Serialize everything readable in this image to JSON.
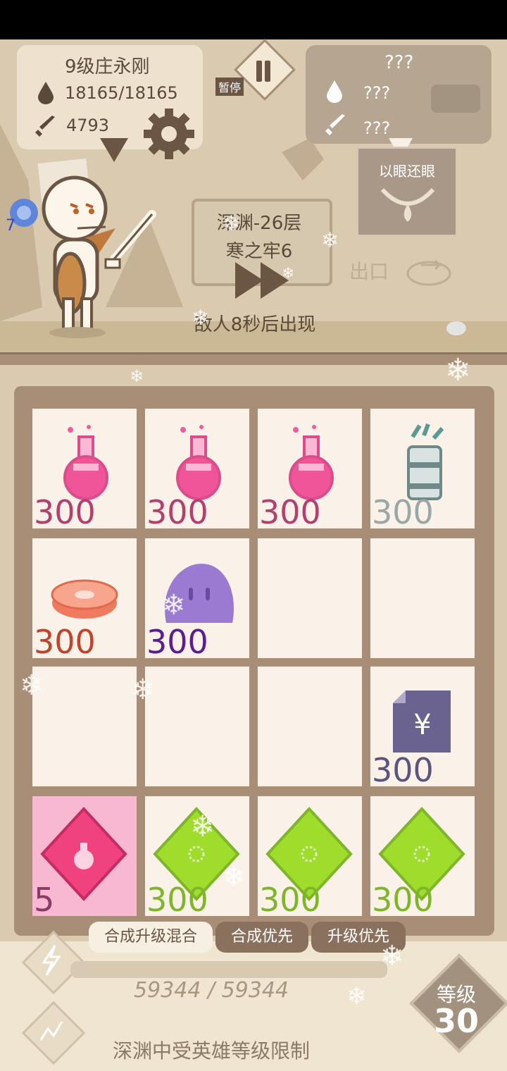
{
  "player": {
    "name": "9级庄永刚",
    "hp": "18165/18165",
    "atk": "4793"
  },
  "enemy": {
    "name": "???",
    "hp": "???",
    "atk": "???",
    "skill": "以眼还眼"
  },
  "pause_tag": "暂停",
  "stage": {
    "line1": "深渊-26层",
    "line2": "寒之牢6",
    "spawn_text": "敌人8秒后出现",
    "exit_text": "出口"
  },
  "buff_count": "7",
  "grid": [
    {
      "item": "pink-potion",
      "count": "300",
      "color": "#b2406e"
    },
    {
      "item": "pink-potion",
      "count": "300",
      "color": "#b2406e"
    },
    {
      "item": "pink-potion",
      "count": "300",
      "color": "#b2406e"
    },
    {
      "item": "arrow-quiver",
      "count": "300",
      "color": "#9aa7a6"
    },
    {
      "item": "meat-steak",
      "count": "300",
      "color": "#c2432b"
    },
    {
      "item": "purple-slime",
      "count": "300",
      "color": "#5b1e91"
    },
    {
      "item": "",
      "count": "",
      "color": ""
    },
    {
      "item": "",
      "count": "",
      "color": ""
    },
    {
      "item": "",
      "count": "",
      "color": ""
    },
    {
      "item": "",
      "count": "",
      "color": ""
    },
    {
      "item": "",
      "count": "",
      "color": ""
    },
    {
      "item": "yen-document",
      "count": "300",
      "color": "#5b557e"
    },
    {
      "item": "pink-potion-gem",
      "count": "5",
      "color": "#8b3b63"
    },
    {
      "item": "green-gem",
      "count": "300",
      "color": "#7fb52b"
    },
    {
      "item": "green-gem",
      "count": "300",
      "color": "#7fb52b"
    },
    {
      "item": "green-gem",
      "count": "300",
      "color": "#7fb52b"
    }
  ],
  "tabs": [
    {
      "label": "合成升级混合"
    },
    {
      "label": "合成优先"
    },
    {
      "label": "升级优先"
    }
  ],
  "xp": "59344 / 59344",
  "limit_text": "深渊中受英雄等级限制",
  "level": {
    "label": "等级",
    "value": "30"
  }
}
